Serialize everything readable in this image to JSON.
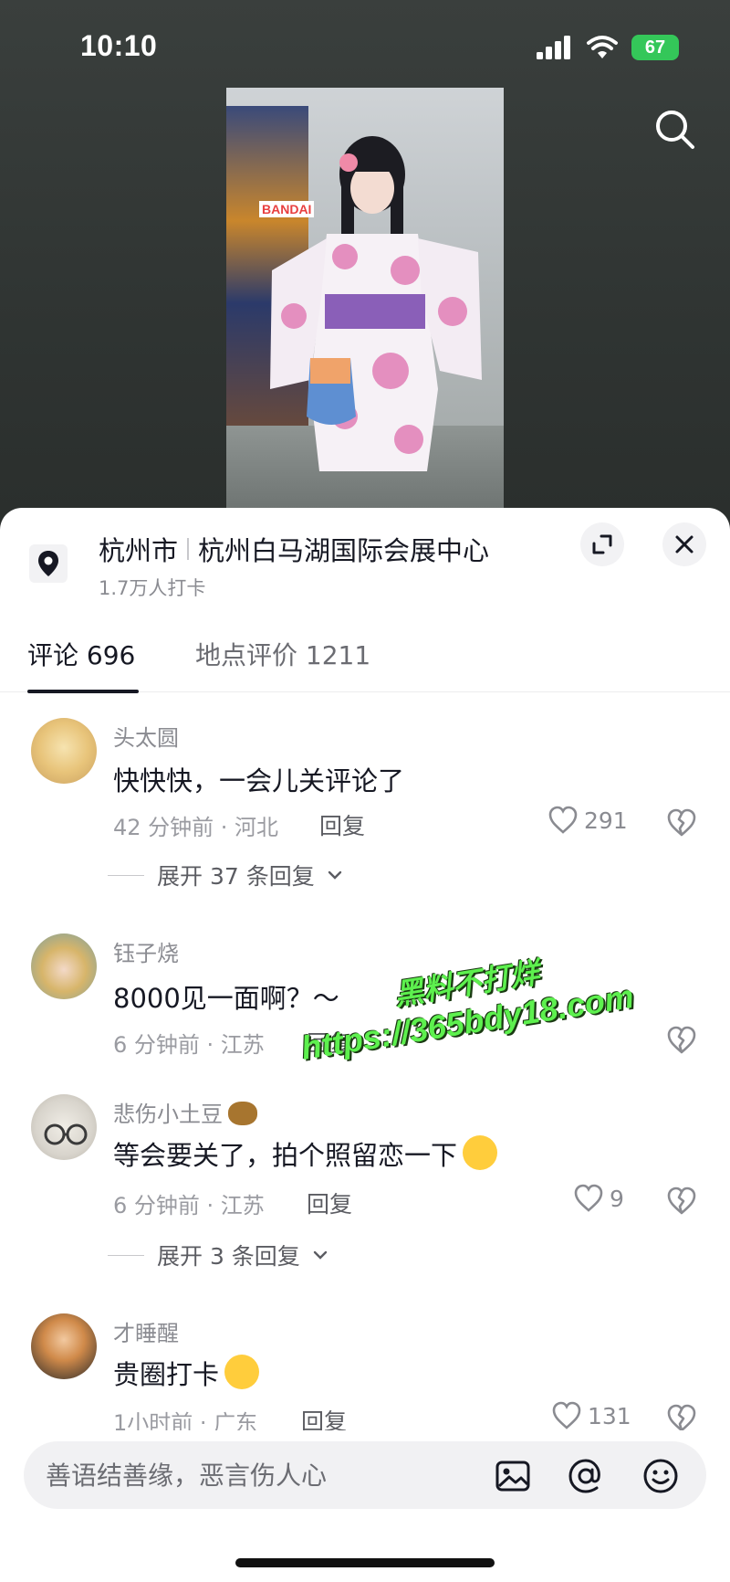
{
  "status_bar": {
    "time": "10:10",
    "battery": "67"
  },
  "location": {
    "city": "杭州市",
    "venue": "杭州白马湖国际会展中心",
    "checkins": "1.7万人打卡"
  },
  "tabs": [
    {
      "label": "评论 696",
      "active": true
    },
    {
      "label": "地点评价 1211",
      "active": false
    }
  ],
  "comments": [
    {
      "user": "头太圆",
      "text": "快快快，一会儿关评论了",
      "meta": "42 分钟前 · 河北",
      "reply_label": "回复",
      "likes": "291",
      "expand": "展开 37 条回复"
    },
    {
      "user": "钰子烧",
      "text": "8000见一面啊？～",
      "meta": "6 分钟前 · 江苏",
      "reply_label": "回复",
      "likes": ""
    },
    {
      "user": "悲伤小土豆",
      "text": "等会要关了，拍个照留恋一下",
      "meta": "6 分钟前 · 江苏",
      "reply_label": "回复",
      "likes": "9",
      "expand": "展开 3 条回复"
    },
    {
      "user": "才睡醒",
      "text": "贵圈打卡",
      "meta": "1小时前 · 广东",
      "reply_label": "回复",
      "likes": "131"
    }
  ],
  "watermark": {
    "line1": "黑料不打烊",
    "line2": "https://365bdy18.com"
  },
  "video": {
    "poster_text": "BANDAI"
  },
  "input": {
    "placeholder": "善语结善缘，恶言伤人心"
  },
  "icons": {
    "search": "search-icon",
    "location": "location-pin-icon",
    "expand": "expand-icon",
    "close": "close-icon",
    "like": "heart-icon",
    "dislike": "broken-heart-icon",
    "image": "image-icon",
    "mention": "at-icon",
    "emoji": "emoji-icon"
  }
}
